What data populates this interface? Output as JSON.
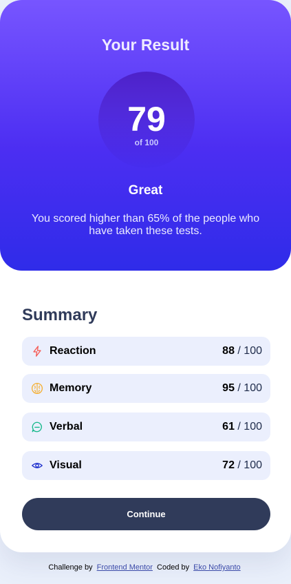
{
  "result": {
    "title": "Your Result",
    "score": "79",
    "score_total": "of 100",
    "rating": "Great",
    "description": "You scored higher than 65% of the people who have taken these tests."
  },
  "summary": {
    "title": "Summary",
    "items": [
      {
        "label": "Reaction",
        "score": "88",
        "total": " / 100",
        "icon": "lightning-icon",
        "color": "#f55e58"
      },
      {
        "label": "Memory",
        "score": "95",
        "total": " / 100",
        "icon": "brain-icon",
        "color": "#f5b034"
      },
      {
        "label": "Verbal",
        "score": "61",
        "total": " / 100",
        "icon": "chat-bubble-icon",
        "color": "#14b88a"
      },
      {
        "label": "Visual",
        "score": "72",
        "total": " / 100",
        "icon": "eye-icon",
        "color": "#1d2ecc"
      }
    ],
    "continue_label": "Continue"
  },
  "footer": {
    "challenge_text": "Challenge by",
    "challenge_link": "Frontend Mentor",
    "coded_text": "Coded by",
    "coded_link": "Eko Nofiyanto"
  }
}
